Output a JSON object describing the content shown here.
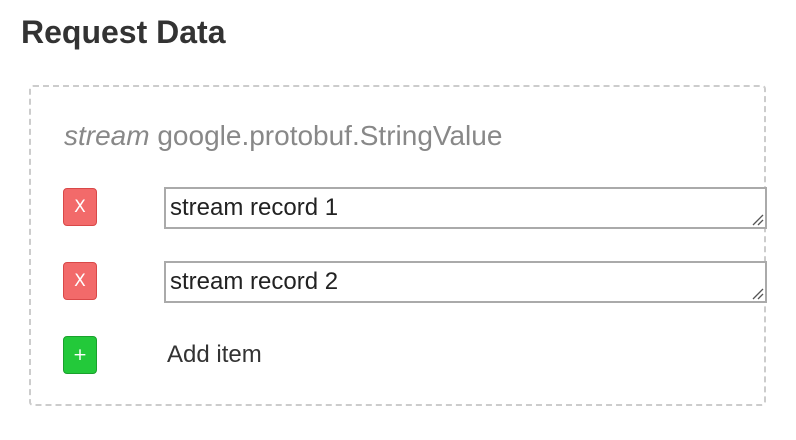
{
  "page": {
    "title": "Request Data"
  },
  "message_type": {
    "keyword": "stream",
    "name": "google.protobuf.StringValue"
  },
  "items": [
    {
      "value": "stream record 1",
      "remove_label": "X"
    },
    {
      "value": "stream record 2",
      "remove_label": "X"
    }
  ],
  "add_item": {
    "icon_label": "+",
    "label": "Add item"
  },
  "colors": {
    "remove_button": "#f26a6a",
    "add_button": "#23c93a",
    "panel_border": "#cccccc"
  }
}
